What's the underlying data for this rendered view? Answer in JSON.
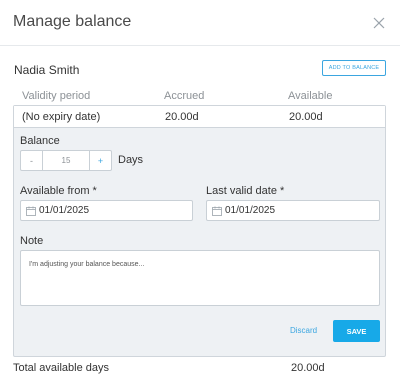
{
  "dialog": {
    "title": "Manage balance"
  },
  "employee": {
    "name": "Nadia Smith",
    "add_button_label": "ADD TO BALANCE"
  },
  "table": {
    "columns": [
      "Validity period",
      "Accrued",
      "Available"
    ],
    "row": {
      "validity": "(No expiry date)",
      "accrued": "20.00d",
      "available": "20.00d"
    }
  },
  "form": {
    "balance_label": "Balance",
    "balance_value": "15",
    "balance_unit": "Days",
    "minus_label": "-",
    "plus_label": "+",
    "available_from_label": "Available from *",
    "available_from_value": "01/01/2025",
    "last_valid_label": "Last valid date *",
    "last_valid_value": "01/01/2025",
    "note_label": "Note",
    "note_placeholder": "I'm adjusting your balance because...",
    "discard_label": "Discard",
    "save_label": "SAVE"
  },
  "summary": {
    "total_label": "Total available days",
    "total_value": "20.00d"
  },
  "colors": {
    "accent": "#17a9e8",
    "link": "#3ba6e0",
    "panel_bg": "#eef1f4"
  },
  "icons": {
    "close": "close-icon",
    "calendar": "calendar-icon"
  }
}
